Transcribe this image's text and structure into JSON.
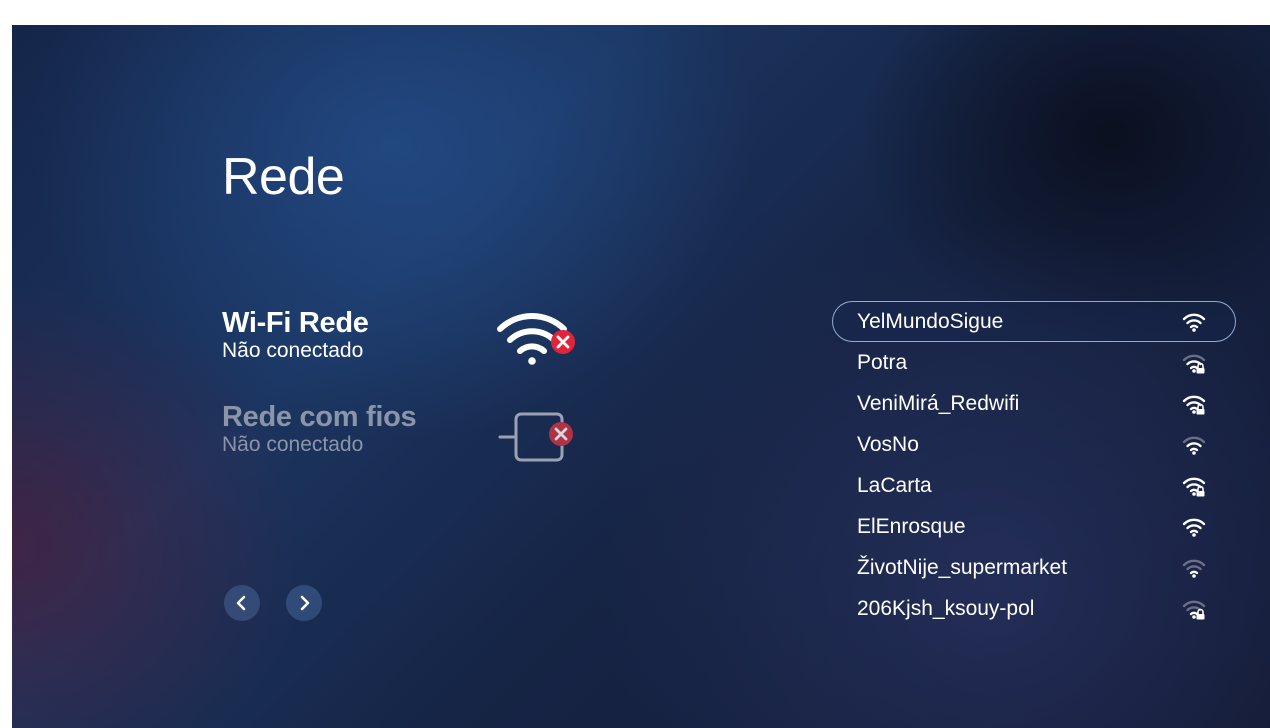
{
  "page": {
    "title": "Rede"
  },
  "connections": [
    {
      "key": "wifi",
      "name": "Wi-Fi Rede",
      "status": "Não conectado",
      "icon": "wifi-disconnected-icon"
    },
    {
      "key": "wired",
      "name": "Rede com fios",
      "status": "Não conectado",
      "icon": "ethernet-disconnected-icon"
    }
  ],
  "nav": {
    "prev_icon": "chevron-left-icon",
    "next_icon": "chevron-right-icon"
  },
  "networks": [
    {
      "name": "YelMundoSigue",
      "signal": 3,
      "secured": false,
      "selected": true
    },
    {
      "name": "Potra",
      "signal": 2,
      "secured": true,
      "selected": false
    },
    {
      "name": "VeniMirá_Redwifi",
      "signal": 3,
      "secured": true,
      "selected": false
    },
    {
      "name": "VosNo",
      "signal": 2,
      "secured": false,
      "selected": false
    },
    {
      "name": "LaCarta",
      "signal": 3,
      "secured": true,
      "selected": false
    },
    {
      "name": "ElEnrosque",
      "signal": 3,
      "secured": false,
      "selected": false
    },
    {
      "name": "ŽivotNije_supermarket",
      "signal": 1,
      "secured": false,
      "selected": false
    },
    {
      "name": "206Kjsh_ksouy-pol",
      "signal": 1,
      "secured": true,
      "selected": false
    }
  ],
  "colors": {
    "error_badge": "#e2243a",
    "selection_border": "#bed7ff",
    "muted_text": "#8c95a8"
  }
}
